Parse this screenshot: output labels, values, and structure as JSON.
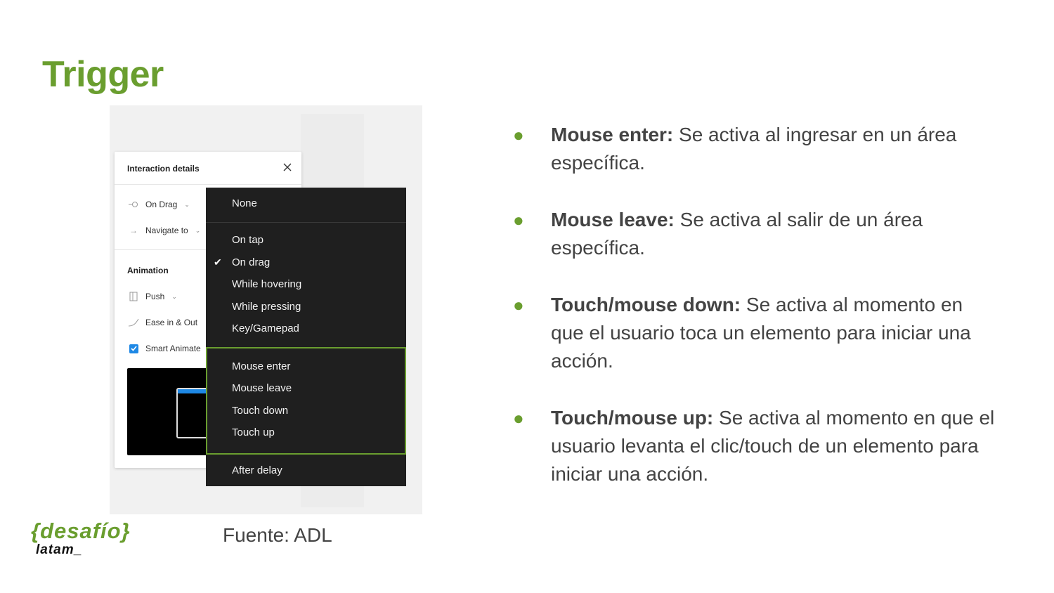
{
  "slide": {
    "title": "Trigger",
    "caption": "Fuente: ADL",
    "logo_top": "{desafío}",
    "logo_bottom": "latam_"
  },
  "panel": {
    "title": "Interaction details",
    "trigger_label": "On Drag",
    "action_label": "Navigate to",
    "section_animation": "Animation",
    "animation_type": "Push",
    "easing": "Ease in & Out",
    "smart_animate": "Smart Animate",
    "smart_animate_checked": true
  },
  "menu": {
    "none": "None",
    "group1": [
      "On tap",
      "On drag",
      "While hovering",
      "While pressing",
      "Key/Gamepad"
    ],
    "selected": "On drag",
    "group2": [
      "Mouse enter",
      "Mouse leave",
      "Touch down",
      "Touch up"
    ],
    "after_delay": "After delay",
    "highlight_color": "#6a9e2f"
  },
  "bullets": [
    {
      "term": "Mouse enter:",
      "text": " Se activa al ingresar en un área específica."
    },
    {
      "term": "Mouse leave:",
      "text": " Se activa al salir de un área específica."
    },
    {
      "term": "Touch/mouse down:",
      "text": " Se activa al momento en que el usuario toca un elemento para iniciar una acción."
    },
    {
      "term": "Touch/mouse up:",
      "text": " Se activa al momento en que el usuario levanta el clic/touch de un elemento para iniciar una acción."
    }
  ],
  "colors": {
    "accent": "#6a9e2f",
    "text": "#434343",
    "menu_bg": "#1f1f1f",
    "checkbox": "#1e88e5"
  }
}
